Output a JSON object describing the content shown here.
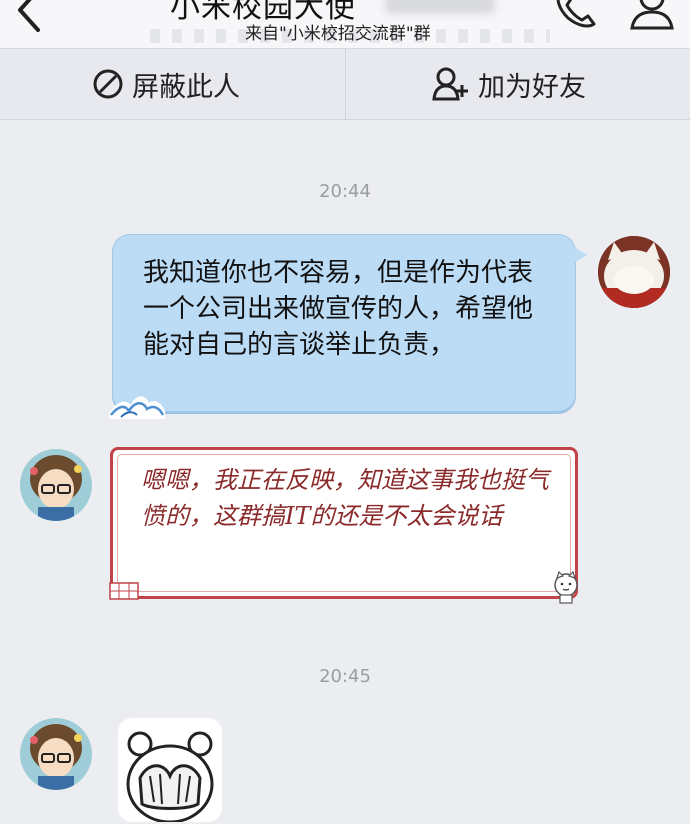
{
  "header": {
    "title": "小米校园大使",
    "subtitle": "来自\"小米校招交流群\"群"
  },
  "actions": {
    "block_label": "屏蔽此人",
    "add_friend_label": "加为好友"
  },
  "messages": [
    {
      "time": "20:44"
    },
    {
      "sender": "me",
      "text": "我知道你也不容易，但是作为代表一个公司出来做宣传的人，希望他能对自己的言谈举止负责，"
    },
    {
      "sender": "other",
      "text": "嗯嗯，我正在反映，知道这事我也挺气愤的，这群搞IT的还是不太会说话"
    },
    {
      "time": "20:45"
    },
    {
      "sender": "other",
      "type": "sticker",
      "icon": "facepalm-bear-sticker"
    }
  ],
  "colors": {
    "background": "#ecedf1",
    "my_bubble": "#bcdcf6",
    "their_bubble_border": "#c0424a",
    "their_text": "#8b2a2a"
  }
}
